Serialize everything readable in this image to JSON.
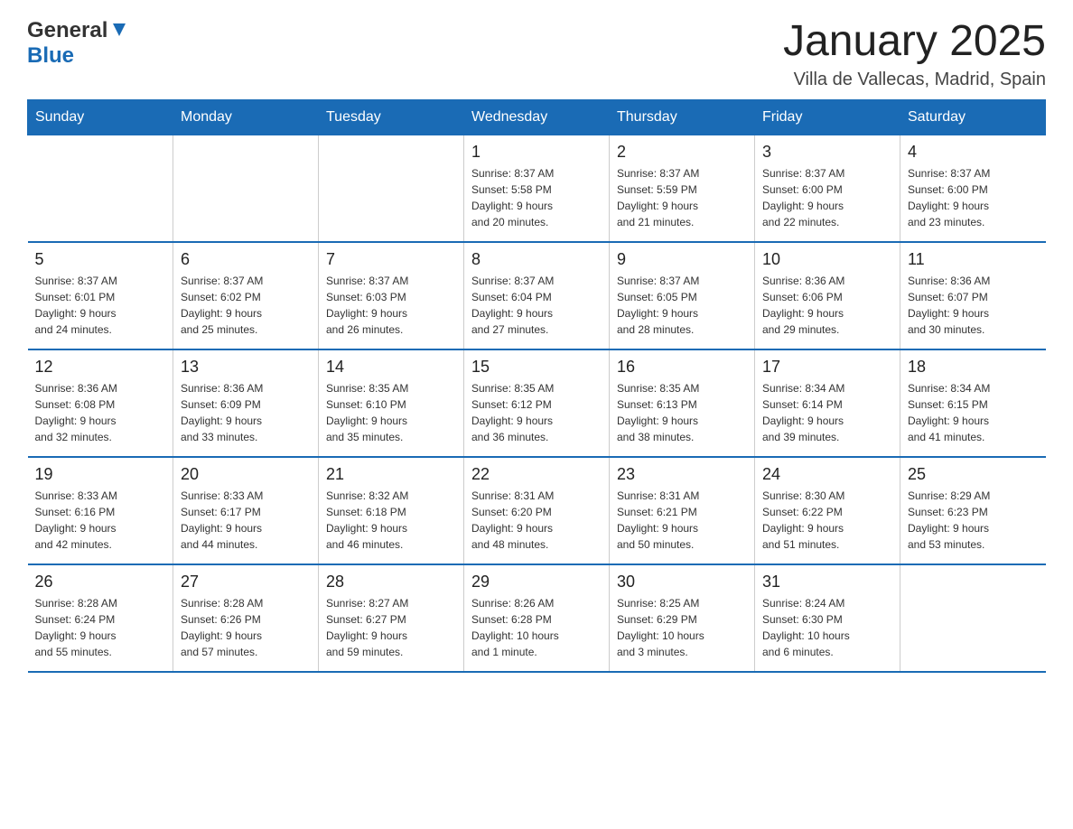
{
  "header": {
    "logo_general": "General",
    "logo_blue": "Blue",
    "title": "January 2025",
    "subtitle": "Villa de Vallecas, Madrid, Spain"
  },
  "calendar": {
    "days_of_week": [
      "Sunday",
      "Monday",
      "Tuesday",
      "Wednesday",
      "Thursday",
      "Friday",
      "Saturday"
    ],
    "weeks": [
      [
        {
          "day": "",
          "info": ""
        },
        {
          "day": "",
          "info": ""
        },
        {
          "day": "",
          "info": ""
        },
        {
          "day": "1",
          "info": "Sunrise: 8:37 AM\nSunset: 5:58 PM\nDaylight: 9 hours\nand 20 minutes."
        },
        {
          "day": "2",
          "info": "Sunrise: 8:37 AM\nSunset: 5:59 PM\nDaylight: 9 hours\nand 21 minutes."
        },
        {
          "day": "3",
          "info": "Sunrise: 8:37 AM\nSunset: 6:00 PM\nDaylight: 9 hours\nand 22 minutes."
        },
        {
          "day": "4",
          "info": "Sunrise: 8:37 AM\nSunset: 6:00 PM\nDaylight: 9 hours\nand 23 minutes."
        }
      ],
      [
        {
          "day": "5",
          "info": "Sunrise: 8:37 AM\nSunset: 6:01 PM\nDaylight: 9 hours\nand 24 minutes."
        },
        {
          "day": "6",
          "info": "Sunrise: 8:37 AM\nSunset: 6:02 PM\nDaylight: 9 hours\nand 25 minutes."
        },
        {
          "day": "7",
          "info": "Sunrise: 8:37 AM\nSunset: 6:03 PM\nDaylight: 9 hours\nand 26 minutes."
        },
        {
          "day": "8",
          "info": "Sunrise: 8:37 AM\nSunset: 6:04 PM\nDaylight: 9 hours\nand 27 minutes."
        },
        {
          "day": "9",
          "info": "Sunrise: 8:37 AM\nSunset: 6:05 PM\nDaylight: 9 hours\nand 28 minutes."
        },
        {
          "day": "10",
          "info": "Sunrise: 8:36 AM\nSunset: 6:06 PM\nDaylight: 9 hours\nand 29 minutes."
        },
        {
          "day": "11",
          "info": "Sunrise: 8:36 AM\nSunset: 6:07 PM\nDaylight: 9 hours\nand 30 minutes."
        }
      ],
      [
        {
          "day": "12",
          "info": "Sunrise: 8:36 AM\nSunset: 6:08 PM\nDaylight: 9 hours\nand 32 minutes."
        },
        {
          "day": "13",
          "info": "Sunrise: 8:36 AM\nSunset: 6:09 PM\nDaylight: 9 hours\nand 33 minutes."
        },
        {
          "day": "14",
          "info": "Sunrise: 8:35 AM\nSunset: 6:10 PM\nDaylight: 9 hours\nand 35 minutes."
        },
        {
          "day": "15",
          "info": "Sunrise: 8:35 AM\nSunset: 6:12 PM\nDaylight: 9 hours\nand 36 minutes."
        },
        {
          "day": "16",
          "info": "Sunrise: 8:35 AM\nSunset: 6:13 PM\nDaylight: 9 hours\nand 38 minutes."
        },
        {
          "day": "17",
          "info": "Sunrise: 8:34 AM\nSunset: 6:14 PM\nDaylight: 9 hours\nand 39 minutes."
        },
        {
          "day": "18",
          "info": "Sunrise: 8:34 AM\nSunset: 6:15 PM\nDaylight: 9 hours\nand 41 minutes."
        }
      ],
      [
        {
          "day": "19",
          "info": "Sunrise: 8:33 AM\nSunset: 6:16 PM\nDaylight: 9 hours\nand 42 minutes."
        },
        {
          "day": "20",
          "info": "Sunrise: 8:33 AM\nSunset: 6:17 PM\nDaylight: 9 hours\nand 44 minutes."
        },
        {
          "day": "21",
          "info": "Sunrise: 8:32 AM\nSunset: 6:18 PM\nDaylight: 9 hours\nand 46 minutes."
        },
        {
          "day": "22",
          "info": "Sunrise: 8:31 AM\nSunset: 6:20 PM\nDaylight: 9 hours\nand 48 minutes."
        },
        {
          "day": "23",
          "info": "Sunrise: 8:31 AM\nSunset: 6:21 PM\nDaylight: 9 hours\nand 50 minutes."
        },
        {
          "day": "24",
          "info": "Sunrise: 8:30 AM\nSunset: 6:22 PM\nDaylight: 9 hours\nand 51 minutes."
        },
        {
          "day": "25",
          "info": "Sunrise: 8:29 AM\nSunset: 6:23 PM\nDaylight: 9 hours\nand 53 minutes."
        }
      ],
      [
        {
          "day": "26",
          "info": "Sunrise: 8:28 AM\nSunset: 6:24 PM\nDaylight: 9 hours\nand 55 minutes."
        },
        {
          "day": "27",
          "info": "Sunrise: 8:28 AM\nSunset: 6:26 PM\nDaylight: 9 hours\nand 57 minutes."
        },
        {
          "day": "28",
          "info": "Sunrise: 8:27 AM\nSunset: 6:27 PM\nDaylight: 9 hours\nand 59 minutes."
        },
        {
          "day": "29",
          "info": "Sunrise: 8:26 AM\nSunset: 6:28 PM\nDaylight: 10 hours\nand 1 minute."
        },
        {
          "day": "30",
          "info": "Sunrise: 8:25 AM\nSunset: 6:29 PM\nDaylight: 10 hours\nand 3 minutes."
        },
        {
          "day": "31",
          "info": "Sunrise: 8:24 AM\nSunset: 6:30 PM\nDaylight: 10 hours\nand 6 minutes."
        },
        {
          "day": "",
          "info": ""
        }
      ]
    ]
  }
}
